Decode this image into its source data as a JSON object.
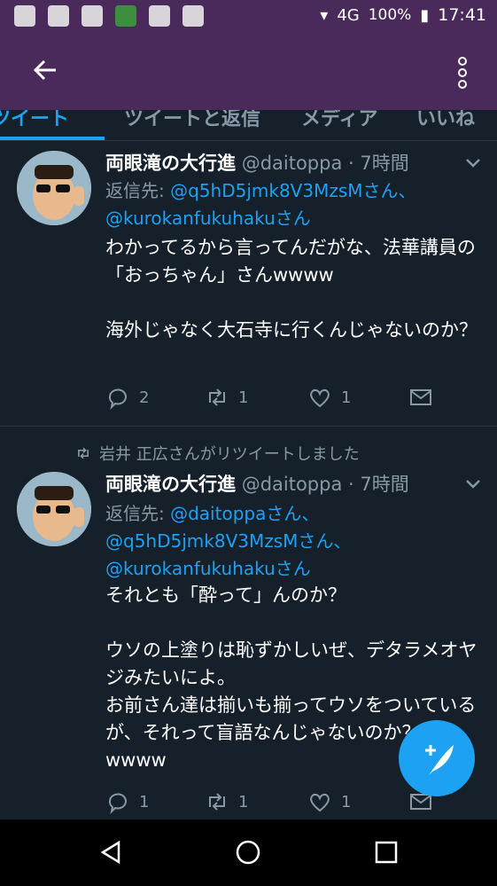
{
  "status": {
    "battery": "100%",
    "time": "17:41",
    "network": "4G"
  },
  "tabs": [
    {
      "label": "ツイート"
    },
    {
      "label": "ツイートと返信"
    },
    {
      "label": "メディア"
    },
    {
      "label": "いいね"
    }
  ],
  "tweets": [
    {
      "name": "両眼滝の大行進",
      "handle": "@daitoppa",
      "sep": " · ",
      "time": "7時間",
      "reply_prefix": "返信先: ",
      "mentions": [
        "@q5hD5jmk8V3MzsMさん、",
        "@kurokanfukuhakuさん"
      ],
      "text": "わかってるから言ってんだがな、法華講員の「おっちゃん」さんwwww\n\n海外じゃなく大石寺に行くんじゃないのか？",
      "replies": "2",
      "retweets": "1",
      "likes": "1"
    },
    {
      "retweeted_by": "岩井 正広さんがリツイートしました",
      "name": "両眼滝の大行進",
      "handle": "@daitoppa",
      "sep": " · ",
      "time": "7時間",
      "reply_prefix": "返信先: ",
      "mentions": [
        "@daitoppaさん、",
        "@q5hD5jmk8V3MzsMさん、",
        "@kurokanfukuhakuさん"
      ],
      "text": "それとも「酔って」んのか？\n\nウソの上塗りは恥ずかしいぜ、デタラメオヤジみたいによ。\nお前さん達は揃いも揃ってウソをついているが、それって盲語なんじゃないのか？\nwwww",
      "replies": "1",
      "retweets": "1",
      "likes": "1"
    }
  ],
  "colors": {
    "accent": "#1da1f2",
    "bg": "#15202b",
    "appbar": "#4a2a5a",
    "muted": "#8899a6"
  }
}
